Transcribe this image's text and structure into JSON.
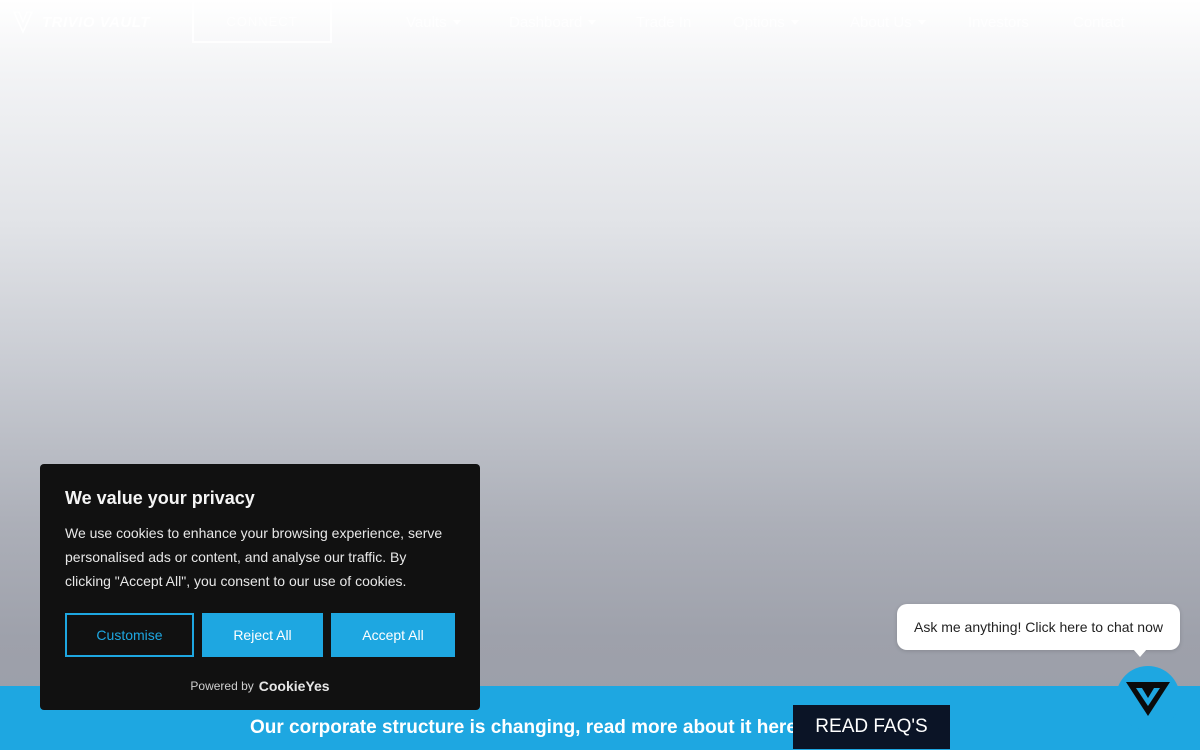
{
  "nav": {
    "logo_text": "TRIVIO VAULT",
    "cta_label": "CONNECT",
    "menu": [
      {
        "label": "Vaults",
        "dropdown": true
      },
      {
        "label": "Dashboard",
        "dropdown": true
      },
      {
        "label": "Trade In",
        "dropdown": false
      },
      {
        "label": "Options",
        "dropdown": true
      },
      {
        "label": "About Us",
        "dropdown": true
      },
      {
        "label": "Investors",
        "dropdown": false
      },
      {
        "label": "Contact",
        "dropdown": false
      }
    ]
  },
  "cookie": {
    "title": "We value your privacy",
    "body": "We use cookies to enhance your browsing experience, serve personalised ads or content, and analyse our traffic. By clicking \"Accept All\", you consent to our use of cookies.",
    "customise_label": "Customise",
    "reject_label": "Reject All",
    "accept_label": "Accept All",
    "powered_by": "Powered by",
    "powered_brand": "CookieYes"
  },
  "banner": {
    "text": "Our corporate structure is changing, read more about it here.",
    "button_label": "READ FAQ'S"
  },
  "chat": {
    "prompt": "Ask me anything! Click here to chat now"
  },
  "colors": {
    "accent": "#1ea7e1",
    "cookie_bg": "#111111",
    "faq_button_bg": "#0b1426"
  }
}
